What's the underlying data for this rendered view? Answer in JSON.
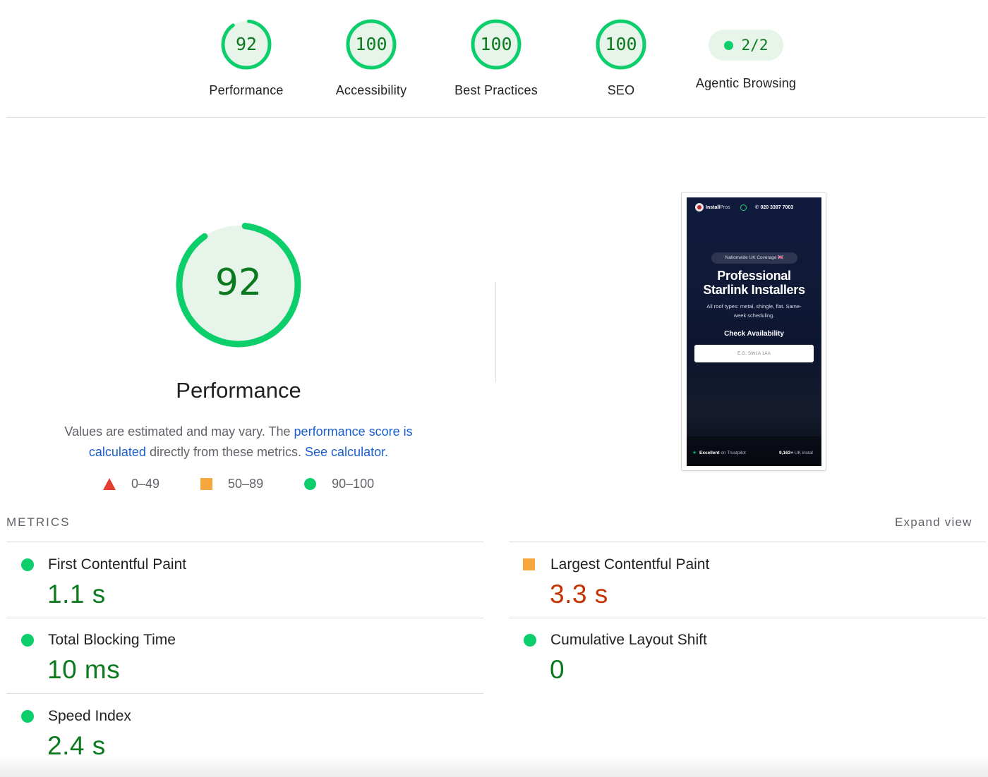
{
  "colors": {
    "pass": "#0cce6b",
    "pass_text": "#0b7a1f",
    "pass_bg": "#e6f4ea",
    "average": "#f6a73c",
    "average_text": "#c33300",
    "fail": "#e33e2f",
    "link": "#1a5fd0"
  },
  "gauges": [
    {
      "score": "92",
      "score_value": 92,
      "label": "Performance"
    },
    {
      "score": "100",
      "score_value": 100,
      "label": "Accessibility"
    },
    {
      "score": "100",
      "score_value": 100,
      "label": "Best Practices"
    },
    {
      "score": "100",
      "score_value": 100,
      "label": "SEO"
    },
    {
      "score": "2/2",
      "label": "Agentic Browsing"
    }
  ],
  "performance": {
    "score": "92",
    "score_value": 92,
    "title": "Performance",
    "desc_1": "Values are estimated and may vary. The ",
    "desc_link_1": "performance score is calculated",
    "desc_2": " directly from these metrics. ",
    "desc_link_2": "See calculator.",
    "legend": [
      {
        "shape": "triangle",
        "range": "0–49"
      },
      {
        "shape": "square",
        "range": "50–89"
      },
      {
        "shape": "circle",
        "range": "90–100"
      }
    ]
  },
  "screenshot": {
    "brand_bold": "Install",
    "brand_thin": "Pros",
    "phone": "020 3397 7003",
    "badge": "Nationwide UK Coverage 🇬🇧",
    "hero_line_1": "Professional",
    "hero_line_2": "Starlink Installers",
    "sub": "All roof types: metal, shingle, flat. Same-week scheduling.",
    "check": "Check Availability",
    "postcode_placeholder": "E.G. SW1A 1AA",
    "trust_bold": "Excellent",
    "trust_rest": " on Trustpilot",
    "uk_count": "9,163+",
    "uk_rest": " UK instal"
  },
  "metrics": {
    "header": "METRICS",
    "expand_label": "Expand view",
    "items": [
      {
        "name": "First Contentful Paint",
        "value": "1.1 s",
        "rating": "pass"
      },
      {
        "name": "Largest Contentful Paint",
        "value": "3.3 s",
        "rating": "average"
      },
      {
        "name": "Total Blocking Time",
        "value": "10 ms",
        "rating": "pass"
      },
      {
        "name": "Cumulative Layout Shift",
        "value": "0",
        "rating": "pass"
      },
      {
        "name": "Speed Index",
        "value": "2.4 s",
        "rating": "pass"
      }
    ]
  }
}
